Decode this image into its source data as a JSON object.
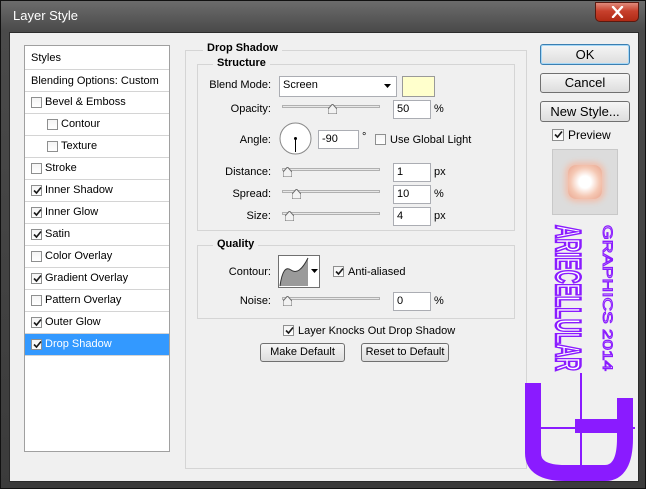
{
  "window": {
    "title": "Layer Style"
  },
  "styles_panel": {
    "header": "Styles",
    "blending": "Blending Options: Custom",
    "items": [
      {
        "label": "Bevel & Emboss",
        "checked": false
      },
      {
        "label": "Contour",
        "checked": false
      },
      {
        "label": "Texture",
        "checked": false
      },
      {
        "label": "Stroke",
        "checked": false
      },
      {
        "label": "Inner Shadow",
        "checked": true
      },
      {
        "label": "Inner Glow",
        "checked": true
      },
      {
        "label": "Satin",
        "checked": true
      },
      {
        "label": "Color Overlay",
        "checked": false
      },
      {
        "label": "Gradient Overlay",
        "checked": true
      },
      {
        "label": "Pattern Overlay",
        "checked": false
      },
      {
        "label": "Outer Glow",
        "checked": true
      },
      {
        "label": "Drop Shadow",
        "checked": true,
        "selected": true
      }
    ]
  },
  "drop_shadow": {
    "title": "Drop Shadow",
    "structure_title": "Structure",
    "blend_mode_label": "Blend Mode:",
    "blend_mode": "Screen",
    "color": "#ffffcc",
    "opacity_label": "Opacity:",
    "opacity": "50",
    "opacity_unit": "%",
    "opacity_level": 0.5,
    "angle_label": "Angle:",
    "angle": "-90",
    "angle_unit": "°",
    "use_global_light_label": "Use Global Light",
    "use_global_light": false,
    "distance_label": "Distance:",
    "distance": "1",
    "distance_unit": "px",
    "distance_level": 0.0,
    "spread_label": "Spread:",
    "spread": "10",
    "spread_unit": "%",
    "spread_level": 0.1,
    "size_label": "Size:",
    "size": "4",
    "size_unit": "px",
    "size_level": 0.02,
    "quality_title": "Quality",
    "contour_label": "Contour:",
    "anti_aliased_label": "Anti-aliased",
    "anti_aliased": true,
    "noise_label": "Noise:",
    "noise": "0",
    "noise_unit": "%",
    "noise_level": 0.0,
    "knockout_label": "Layer Knocks Out Drop Shadow",
    "knockout": true,
    "make_default": "Make Default",
    "reset_default": "Reset to Default"
  },
  "buttons": {
    "ok": "OK",
    "cancel": "Cancel",
    "new_style": "New Style...",
    "preview_label": "Preview",
    "preview": true
  },
  "watermark": {
    "brand": "ARIECELLULAR",
    "sub": "GRAPHICS 2014",
    "color": "#8a1bff"
  }
}
